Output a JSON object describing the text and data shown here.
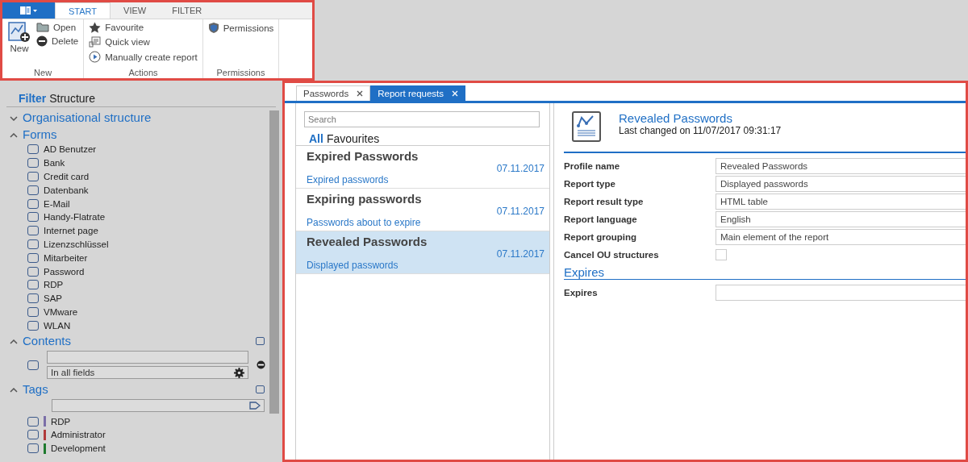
{
  "ribbon": {
    "tabs": [
      {
        "label": "START",
        "selected": true
      },
      {
        "label": "VIEW",
        "selected": false
      },
      {
        "label": "FILTER",
        "selected": false
      }
    ],
    "groups": [
      {
        "label": "New",
        "items": [
          {
            "label": "New",
            "kind": "large"
          },
          {
            "label": "Open",
            "kind": "small"
          },
          {
            "label": "Delete",
            "kind": "small"
          }
        ]
      },
      {
        "label": "Actions",
        "items": [
          {
            "label": "Favourite",
            "kind": "small"
          },
          {
            "label": "Quick view",
            "kind": "small"
          },
          {
            "label": "Manually create report",
            "kind": "small"
          }
        ]
      },
      {
        "label": "Permissions",
        "items": [
          {
            "label": "Permissions",
            "kind": "small"
          }
        ]
      }
    ]
  },
  "sidebar": {
    "header": [
      {
        "label": "Filter",
        "selected": true
      },
      {
        "label": "Structure",
        "selected": false
      }
    ],
    "sections": [
      {
        "title": "Organisational structure",
        "expanded": false,
        "kind": "tree"
      },
      {
        "title": "Forms",
        "expanded": true,
        "kind": "checklist",
        "items": [
          {
            "label": "AD Benutzer",
            "checked": false
          },
          {
            "label": "Bank",
            "checked": false
          },
          {
            "label": "Credit card",
            "checked": false
          },
          {
            "label": "Datenbank",
            "checked": false
          },
          {
            "label": "E-Mail",
            "checked": false
          },
          {
            "label": "Handy-Flatrate",
            "checked": false
          },
          {
            "label": "Internet page",
            "checked": false
          },
          {
            "label": "Lizenzschlüssel",
            "checked": false
          },
          {
            "label": "Mitarbeiter",
            "checked": false
          },
          {
            "label": "Password",
            "checked": false
          },
          {
            "label": "RDP",
            "checked": false
          },
          {
            "label": "SAP",
            "checked": false
          },
          {
            "label": "VMware",
            "checked": false
          },
          {
            "label": "WLAN",
            "checked": false
          }
        ]
      },
      {
        "title": "Contents",
        "expanded": true,
        "kind": "search",
        "option": "In all fields",
        "checked": false,
        "all_checked": false
      },
      {
        "title": "Tags",
        "expanded": true,
        "kind": "tags",
        "all_checked": false,
        "items": [
          {
            "label": "RDP",
            "checked": false,
            "color": "#7b6fa8"
          },
          {
            "label": "Administrator",
            "checked": false,
            "color": "#b03a3a"
          },
          {
            "label": "Development",
            "checked": false,
            "color": "#1e7a2e"
          }
        ]
      }
    ]
  },
  "tabs": [
    {
      "label": "Passwords",
      "selected": false
    },
    {
      "label": "Report requests",
      "selected": true
    }
  ],
  "list": {
    "search": {
      "placeholder": "Search"
    },
    "filters": [
      {
        "label": "All",
        "selected": true
      },
      {
        "label": "Favourites",
        "selected": false
      }
    ],
    "items": [
      {
        "title": "Expired Passwords",
        "date": "07.11.2017",
        "subtitle": "Expired passwords",
        "selected": false
      },
      {
        "title": "Expiring passwords",
        "date": "07.11.2017",
        "subtitle": "Passwords about to expire",
        "selected": false
      },
      {
        "title": "Revealed Passwords",
        "date": "07.11.2017",
        "subtitle": "Displayed passwords",
        "selected": true
      }
    ]
  },
  "detail": {
    "title": "Revealed Passwords",
    "subtitle": "Last changed on 11/07/2017 09:31:17",
    "fields": [
      {
        "label": "Profile name",
        "kind": "text",
        "value": "Revealed Passwords"
      },
      {
        "label": "Report type",
        "kind": "text",
        "value": "Displayed passwords"
      },
      {
        "label": "Report result type",
        "kind": "text",
        "value": "HTML table"
      },
      {
        "label": "Report language",
        "kind": "text",
        "value": "English"
      },
      {
        "label": "Report grouping",
        "kind": "text",
        "value": "Main element of the report"
      },
      {
        "label": "Cancel OU structures",
        "kind": "checkbox",
        "checked": false
      }
    ],
    "sections": [
      {
        "title": "Expires",
        "fields": [
          {
            "label": "Expires",
            "kind": "text"
          }
        ]
      }
    ]
  }
}
